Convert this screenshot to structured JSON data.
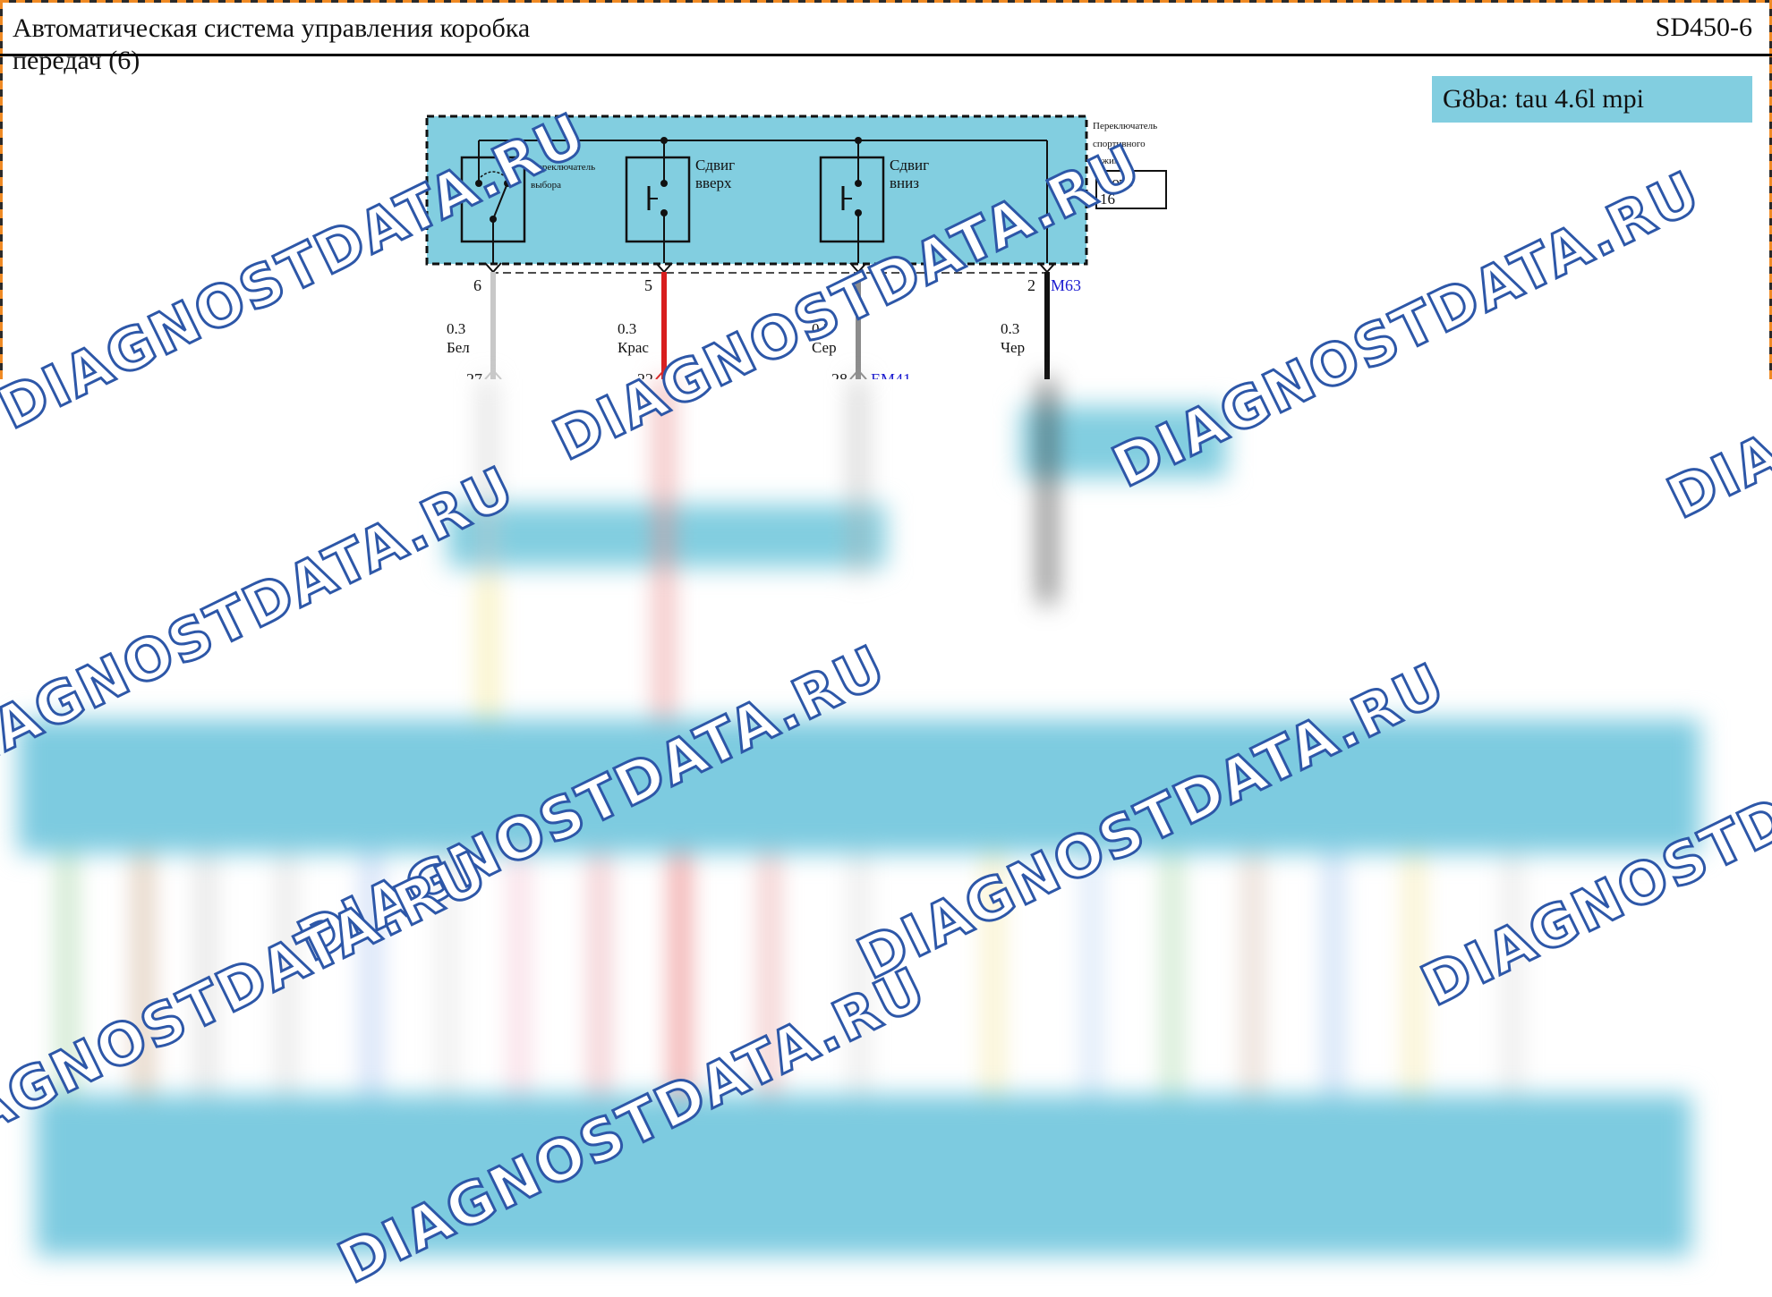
{
  "header": {
    "title": "Автоматическая система управления коробка передач (6)",
    "code": "SD450-6"
  },
  "engine_badge": "G8ba: tau 4.6l mpi",
  "module": {
    "name_lines": [
      "Переключатель",
      "спортивного",
      "режима"
    ],
    "photo_label": "Фото",
    "photo_number": "16",
    "connector": "M63",
    "switches": [
      {
        "label_lines": [
          "Переключатель",
          "выбора"
        ]
      },
      {
        "label_lines": [
          "Сдвиг",
          "вверх"
        ]
      },
      {
        "label_lines": [
          "Сдвиг",
          "вниз"
        ]
      }
    ]
  },
  "wires": [
    {
      "pin": "6",
      "gauge": "0.3",
      "color_name": "Бел",
      "color": "#c8c8c8",
      "lower_pin": "27"
    },
    {
      "pin": "5",
      "gauge": "0.3",
      "color_name": "Крас",
      "color": "#d81e1e",
      "lower_pin": "22"
    },
    {
      "pin": "7",
      "gauge": "0.3",
      "color_name": "Сер",
      "color": "#8c8c8c",
      "lower_pin": "28"
    },
    {
      "pin": "2",
      "gauge": "0.3",
      "color_name": "Чер",
      "color": "#111111",
      "lower_pin": ""
    }
  ],
  "lower_connector": "EM41",
  "watermarks": [
    "DIAGNOSTDATA.RU",
    "DIAGNOSTDATA.RU",
    "DIAGNOSTDATA.RU",
    "DIAGNOSTDATA.RU",
    "DIAGNOSTDATA.RU",
    "DIAGNOSTDATA.RU",
    "DIAGNOSTDATA.RU",
    "DIAGNOSTDATA.RU",
    "DIAGNOSTDATA.RU",
    "DIAGNOSTDATA.RU"
  ]
}
